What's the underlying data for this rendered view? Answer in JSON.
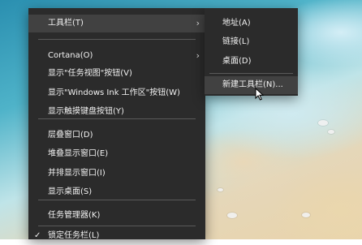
{
  "context_menu": {
    "items": [
      {
        "label": "工具栏(T)",
        "submenu": true
      },
      {
        "label": "Cortana(O)",
        "submenu": true
      },
      {
        "label": "显示\"任务视图\"按钮(V)"
      },
      {
        "label": "显示\"Windows Ink 工作区\"按钮(W)"
      },
      {
        "label": "显示触摸键盘按钮(Y)"
      },
      {
        "label": "层叠窗口(D)"
      },
      {
        "label": "堆叠显示窗口(E)"
      },
      {
        "label": "并排显示窗口(I)"
      },
      {
        "label": "显示桌面(S)"
      },
      {
        "label": "任务管理器(K)"
      },
      {
        "label": "锁定任务栏(L)",
        "checked": true
      }
    ],
    "arrow_glyph": "›",
    "check_glyph": "✓"
  },
  "toolbars_submenu": {
    "items": [
      {
        "label": "地址(A)"
      },
      {
        "label": "链接(L)"
      },
      {
        "label": "桌面(D)"
      },
      {
        "label": "新建工具栏(N)..."
      }
    ]
  },
  "colors": {
    "menu_bg": "#2b2b2b",
    "menu_hover": "#414141",
    "menu_text": "#f2f2f2",
    "separator": "#5a5a5a"
  }
}
